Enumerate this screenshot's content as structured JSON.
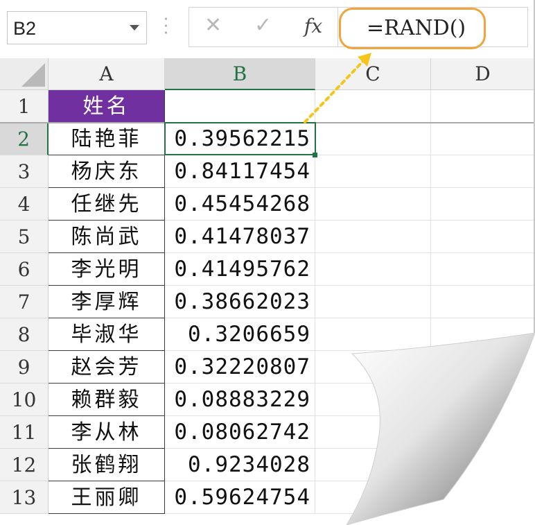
{
  "formula_bar": {
    "name_box": "B2",
    "cancel_icon": "✕",
    "enter_icon": "✓",
    "fx_label": "fx",
    "formula": "=RAND()"
  },
  "columns": [
    "A",
    "B",
    "C",
    "D"
  ],
  "rows": [
    {
      "num": "1",
      "name": "姓名",
      "value": ""
    },
    {
      "num": "2",
      "name": "陆艳菲",
      "value": "0.39562215"
    },
    {
      "num": "3",
      "name": "杨庆东",
      "value": "0.84117454"
    },
    {
      "num": "4",
      "name": "任继先",
      "value": "0.45454268"
    },
    {
      "num": "5",
      "name": "陈尚武",
      "value": "0.41478037"
    },
    {
      "num": "6",
      "name": "李光明",
      "value": "0.41495762"
    },
    {
      "num": "7",
      "name": "李厚辉",
      "value": "0.38662023"
    },
    {
      "num": "8",
      "name": "毕淑华",
      "value": "0.3206659"
    },
    {
      "num": "9",
      "name": "赵会芳",
      "value": "0.32220807"
    },
    {
      "num": "10",
      "name": "赖群毅",
      "value": "0.08883229"
    },
    {
      "num": "11",
      "name": "李从林",
      "value": "0.08062742"
    },
    {
      "num": "12",
      "name": "张鹤翔",
      "value": "0.9234028"
    },
    {
      "num": "13",
      "name": "王丽卿",
      "value": "0.59624754"
    }
  ],
  "colors": {
    "header_fill": "#7030a0",
    "accent": "#217346",
    "callout": "#f0a43a",
    "arrow": "#f5c518"
  },
  "icons": {
    "name_box_dropdown": "chevron-down-icon",
    "cancel": "close-icon",
    "enter": "check-icon",
    "function": "fx-icon"
  }
}
